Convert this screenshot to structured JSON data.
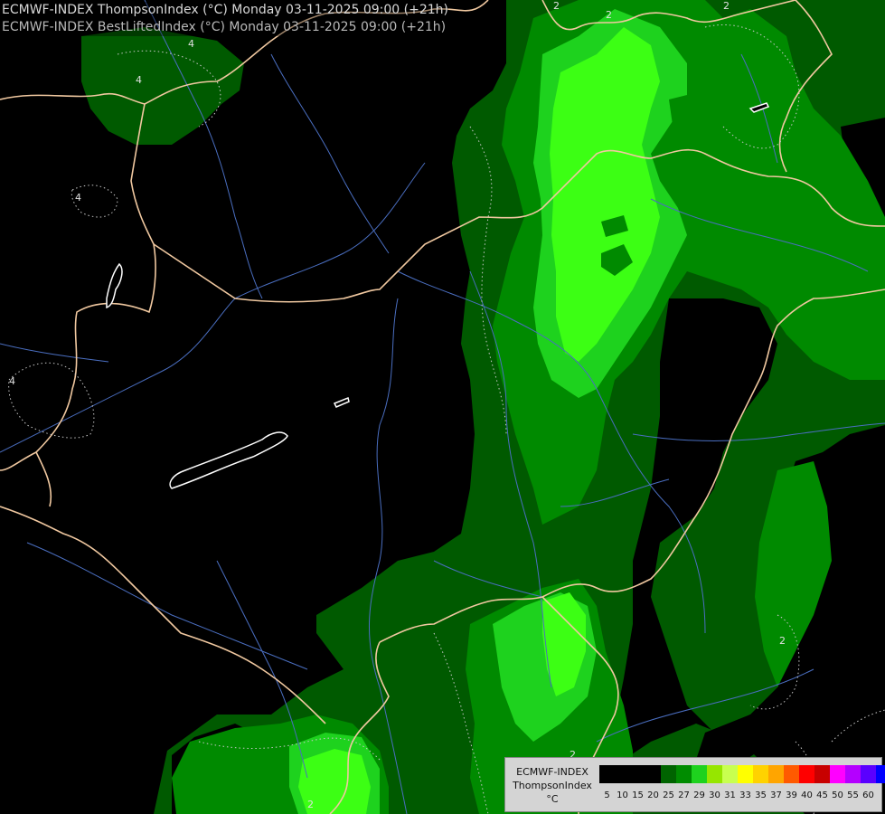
{
  "title": {
    "line1": "ECMWF-INDEX ThompsonIndex (°C) Monday 03-11-2025 09:00 (+21h)",
    "line2": "ECMWF-INDEX BestLiftedIndex (°C) Monday 03-11-2025 09:00 (+21h)"
  },
  "legend": {
    "line1": "ECMWF-INDEX",
    "line2": "ThompsonIndex",
    "unit": "°C",
    "ticks": [
      "5",
      "10",
      "15",
      "20",
      "25",
      "27",
      "29",
      "30",
      "31",
      "33",
      "35",
      "37",
      "39",
      "40",
      "45",
      "50",
      "55",
      "60"
    ],
    "colors": [
      "#000000",
      "#000000",
      "#000000",
      "#000000",
      "#006400",
      "#008c00",
      "#1ed21e",
      "#96e600",
      "#c8ff50",
      "#ffff00",
      "#ffd200",
      "#ffa500",
      "#ff5a00",
      "#ff0000",
      "#c80000",
      "#ff00ff",
      "#b400ff",
      "#5a00ff",
      "#0000ff"
    ]
  },
  "contour_labels": [
    "4",
    "4",
    "4",
    "4",
    "2",
    "2",
    "2",
    "2",
    "2",
    "2"
  ],
  "colors": {
    "background": "#000000",
    "level_25": "#005a00",
    "level_27": "#008a00",
    "level_29": "#1ed21e",
    "level_30": "#3cff14",
    "border": "#f0c8a0",
    "river": "#5078c8",
    "lake": "#ffffff",
    "contour": "#c8c8c8"
  }
}
